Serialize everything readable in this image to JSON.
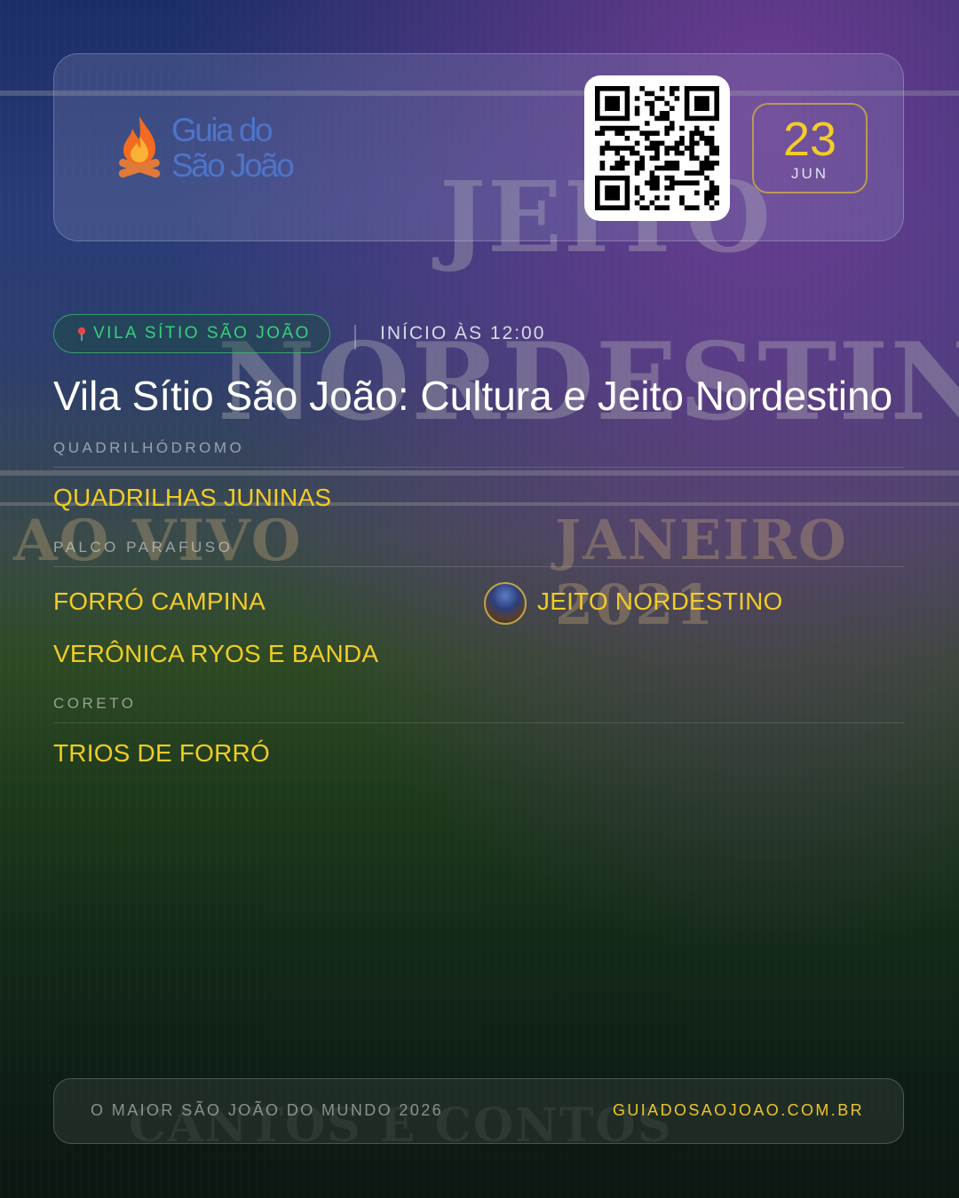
{
  "brand": {
    "line1": "Guia do",
    "line2": "São João"
  },
  "date": {
    "day": "23",
    "month": "JUN"
  },
  "location": {
    "venue": "VILA SÍTIO SÃO JOÃO",
    "start": "INÍCIO ÀS 12:00"
  },
  "event": {
    "title": "Vila Sítio São João: Cultura e Jeito Nordestino"
  },
  "stages": [
    {
      "name": "QUADRILHÓDROMO",
      "acts": [
        "QUADRILHAS JUNINAS"
      ]
    },
    {
      "name": "PALCO PARAFUSO",
      "acts": [
        "FORRÓ CAMPINA",
        "JEITO NORDESTINO",
        "VERÔNICA RYOS E BANDA"
      ]
    },
    {
      "name": "CORETO",
      "acts": [
        "TRIOS DE FORRÓ"
      ]
    }
  ],
  "footer": {
    "tagline": "O MAIOR SÃO JOÃO DO MUNDO 2026",
    "site": "GUIADOSAOJOAO.COM.BR"
  },
  "background": {
    "words": [
      "JEITO",
      "NORDESTINO",
      "AO VIVO",
      "JANEIRO 2021",
      "CANTOS E CONTOS"
    ]
  },
  "colors": {
    "accent_yellow": "#f1cc24",
    "venue_green": "#35d27a",
    "brand_blue": "#4d74c8"
  }
}
